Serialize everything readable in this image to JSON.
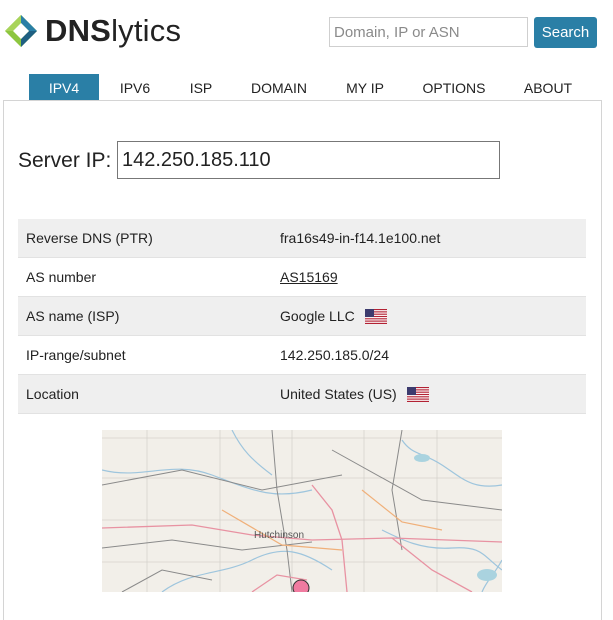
{
  "brand": {
    "name_bold": "DNS",
    "name_rest": "lytics"
  },
  "search": {
    "placeholder": "Domain, IP or ASN",
    "button_label": "Search"
  },
  "nav": {
    "tabs": [
      {
        "label": "IPV4",
        "active": true
      },
      {
        "label": "IPV6"
      },
      {
        "label": "ISP"
      },
      {
        "label": "DOMAIN"
      },
      {
        "label": "MY IP"
      },
      {
        "label": "OPTIONS"
      },
      {
        "label": "ABOUT"
      }
    ]
  },
  "server": {
    "label": "Server IP:",
    "value": "142.250.185.110"
  },
  "info": {
    "rows": [
      {
        "key": "Reverse DNS (PTR)",
        "value": "fra16s49-in-f14.1e100.net"
      },
      {
        "key": "AS number",
        "value": "AS15169"
      },
      {
        "key": "AS name (ISP)",
        "value": "Google LLC"
      },
      {
        "key": "IP-range/subnet",
        "value": "142.250.185.0/24"
      },
      {
        "key": "Location",
        "value": "United States (US)"
      }
    ]
  },
  "map": {
    "city_label": "Hutchinson"
  },
  "colors": {
    "accent": "#2a7fa6",
    "row_alt": "#efefef",
    "marker": "#f07ba0"
  },
  "icons": {
    "logo": "dnslytics-logo-icon",
    "flag": "us-flag-icon",
    "marker": "map-marker-icon"
  }
}
